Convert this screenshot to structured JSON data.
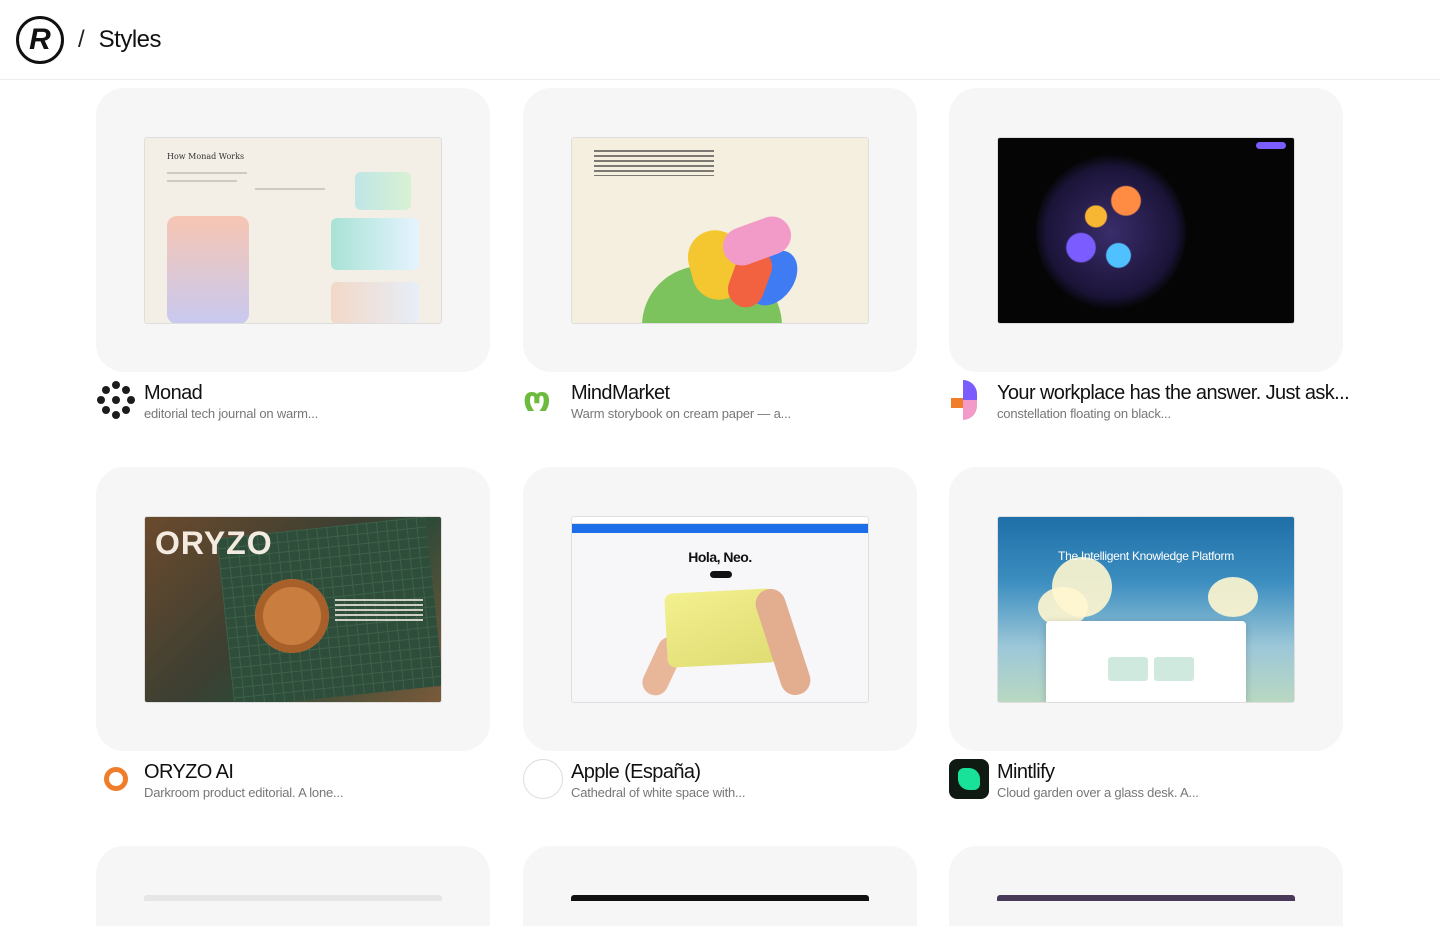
{
  "header": {
    "logo_glyph": "R",
    "separator": "/",
    "breadcrumb": "Styles"
  },
  "cards": [
    {
      "title": "Monad",
      "desc": "editorial tech journal on warm...",
      "icon": "dots-logo-icon",
      "thumb_heading": "How Monad Works"
    },
    {
      "title": "MindMarket",
      "desc": "Warm storybook on cream paper — a...",
      "icon": "mindmarket-logo-icon",
      "icon_glyph": "ო"
    },
    {
      "title": "Your workplace has the answer. Just ask...",
      "desc": "constellation floating on black...",
      "icon": "glean-logo-icon"
    },
    {
      "title": "ORYZO AI",
      "desc": "Darkroom product editorial. A lone...",
      "icon": "ring-logo-icon",
      "thumb_word": "ORYZO"
    },
    {
      "title": "Apple (España)",
      "desc": "Cathedral of white space with...",
      "icon": "apple-logo-icon",
      "icon_glyph": "",
      "thumb_heading": "Hola, Neo."
    },
    {
      "title": "Mintlify",
      "desc": "Cloud garden over a glass desk. A...",
      "icon": "mintlify-logo-icon",
      "thumb_heading": "The Intelligent Knowledge Platform"
    }
  ],
  "colors": {
    "accent_green": "#6dbb3c",
    "accent_orange": "#f07d2a",
    "mint": "#18e299",
    "card_bg": "#f6f6f6"
  }
}
